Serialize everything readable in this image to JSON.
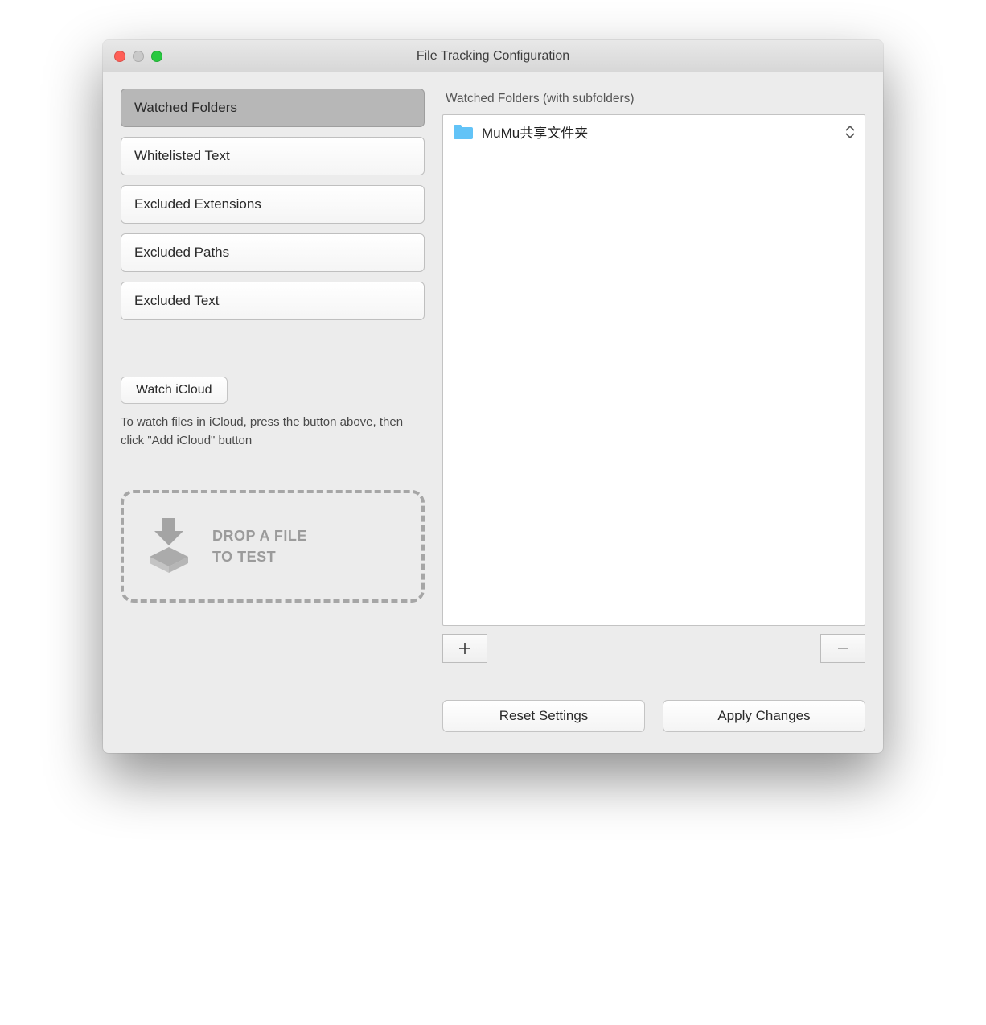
{
  "window": {
    "title": "File Tracking Configuration"
  },
  "sidebar": {
    "tabs": [
      {
        "label": "Watched Folders",
        "selected": true
      },
      {
        "label": "Whitelisted Text",
        "selected": false
      },
      {
        "label": "Excluded Extensions",
        "selected": false
      },
      {
        "label": "Excluded Paths",
        "selected": false
      },
      {
        "label": "Excluded Text",
        "selected": false
      }
    ],
    "icloud_button": "Watch iCloud",
    "icloud_hint": "To watch files in iCloud, press the button above, then click \"Add iCloud\" button",
    "dropzone_line1": "DROP A FILE",
    "dropzone_line2": "TO TEST"
  },
  "panel": {
    "header": "Watched Folders (with subfolders)",
    "items": [
      {
        "name": "MuMu共享文件夹"
      }
    ]
  },
  "buttons": {
    "reset": "Reset Settings",
    "apply": "Apply Changes"
  }
}
